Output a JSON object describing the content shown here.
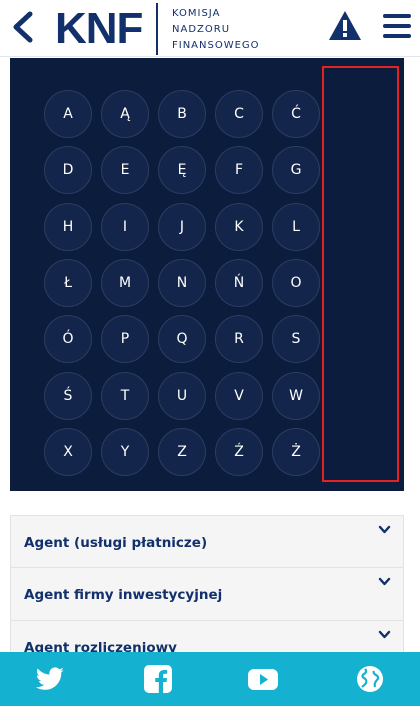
{
  "header": {
    "logo_abbr": "KNF",
    "logo_lines": [
      "KOMISJA",
      "NADZORU",
      "FINANSOWEGO"
    ],
    "back_icon": "chevron-left-icon",
    "warning_icon": "warning-icon",
    "menu_icon": "hamburger-menu-icon"
  },
  "alphabet": {
    "letters": [
      "A",
      "Ą",
      "B",
      "C",
      "Ć",
      "D",
      "E",
      "Ę",
      "F",
      "G",
      "H",
      "I",
      "J",
      "K",
      "L",
      "Ł",
      "M",
      "N",
      "Ń",
      "O",
      "Ó",
      "P",
      "Q",
      "R",
      "S",
      "Ś",
      "T",
      "U",
      "V",
      "W",
      "X",
      "Y",
      "Z",
      "Ź",
      "Ż"
    ]
  },
  "accordion": {
    "items": [
      {
        "label": "Agent (usługi płatnicze)"
      },
      {
        "label": "Agent firmy inwestycyjnej"
      },
      {
        "label": "Agent rozliczeniowy"
      }
    ]
  },
  "social": {
    "icons": [
      "twitter-icon",
      "facebook-icon",
      "youtube-icon",
      "globe-icon"
    ]
  },
  "colors": {
    "navy": "#12306b",
    "panel": "#0c1c3d",
    "social_bar": "#14b1d1",
    "highlight": "#e52222"
  }
}
